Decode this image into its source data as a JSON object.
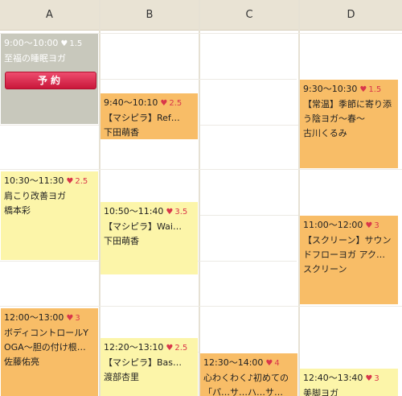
{
  "columns": [
    "A",
    "B",
    "C",
    "D"
  ],
  "slots": {
    "a1": {
      "time": "9:00〜10:00",
      "rating": "1.5",
      "title1": "至福の睡眠ヨガ",
      "button": "予約"
    },
    "a2": {
      "time": "10:30〜11:30",
      "rating": "2.5",
      "title1": "肩こり改善ヨガ",
      "instructor": "橋本彩"
    },
    "a3": {
      "time": "12:00〜13:00",
      "rating": "3",
      "title1": "ボディコントロールY",
      "title2": "OGA〜胆の付け根…",
      "instructor": "佐藤佑亮"
    },
    "b1": {
      "time": "9:40〜10:10",
      "rating": "2.5",
      "title1": "【マシピラ】Ref…",
      "instructor": "下田萌香"
    },
    "b2": {
      "time": "10:50〜11:40",
      "rating": "3.5",
      "title1": "【マシピラ】Wai…",
      "instructor": "下田萌香"
    },
    "b3": {
      "time": "12:20〜13:10",
      "rating": "2.5",
      "title1": "【マシピラ】Bas…",
      "instructor": "渡部杏里"
    },
    "c1": {
      "time": "12:30〜14:00",
      "rating": "4",
      "title1": "心わくわく♪初めての",
      "title2": "「パ…サ…ハ…サ…"
    },
    "d1": {
      "time": "9:30〜10:30",
      "rating": "1.5",
      "title1": "【常温】季節に寄り添",
      "title2": "う陰ヨガ〜春〜",
      "instructor": "古川くるみ"
    },
    "d2": {
      "time": "11:00〜12:00",
      "rating": "3",
      "title1": "【スクリーン】サウン",
      "title2": "ドフローヨガ アク…",
      "instructor": "スクリーン"
    },
    "d3": {
      "time": "12:40〜13:40",
      "rating": "3",
      "title1": "美脚ヨガ"
    }
  },
  "icons": {
    "favorite": "heart-icon"
  },
  "colors": {
    "yellow": "#fcf5a9",
    "orange": "#f8bd67",
    "past": "#c8c8bc",
    "heart": "#d9364a",
    "button": "#d8234a"
  }
}
